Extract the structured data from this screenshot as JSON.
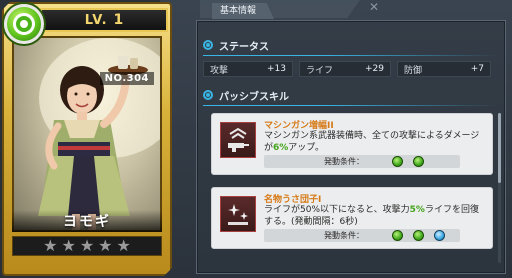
{
  "card": {
    "level_prefix": "LV.",
    "level_value": "1",
    "number": "NO.304",
    "name": "ヨモギ",
    "stars_total": 5,
    "stars_filled": 0
  },
  "panel": {
    "tab_label": "基本情報",
    "status_title": "ステータス",
    "stats": [
      {
        "label": "攻撃",
        "value": "+13"
      },
      {
        "label": "ライフ",
        "value": "+29"
      },
      {
        "label": "防御",
        "value": "+7"
      }
    ],
    "passive_title": "パッシブスキル",
    "skills": [
      {
        "name": "マシンガン増幅II",
        "desc_pre": "マシンガン系武器装備時、全ての攻撃によるダメージが",
        "desc_hl": "6%",
        "desc_post": "アップ。",
        "condition_label": "発動条件：",
        "condition_icons": [
          "green",
          "green"
        ]
      },
      {
        "name": "名物うさ団子I",
        "desc_pre": "ライフが50%以下になると、攻撃力",
        "desc_hl": "5%",
        "desc_post": "ライフを回復する。(発動間隔：6秒)",
        "condition_label": "発動条件：",
        "condition_icons": [
          "green",
          "green",
          "blue"
        ]
      }
    ]
  },
  "colors": {
    "accent_blue": "#39b5e4",
    "gold": "#e8c755",
    "skill_name_orange": "#d67a16",
    "highlight_green": "#44a51c"
  }
}
